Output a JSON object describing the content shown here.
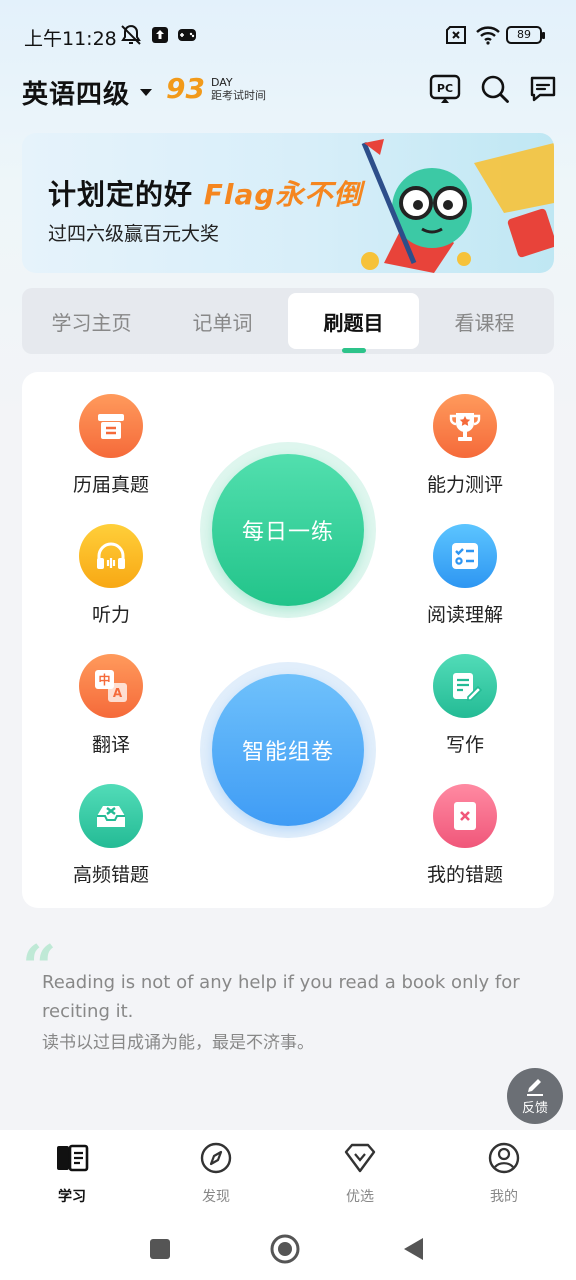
{
  "status_bar": {
    "time": "上午11:28",
    "battery": "89"
  },
  "header": {
    "exam_title": "英语四级",
    "countdown_number": "93",
    "countdown_unit": "DAY",
    "countdown_label": "距考试时间",
    "pc_icon_text": "PC"
  },
  "banner": {
    "title_prefix": "计划定的好",
    "title_highlight": "Flag永不倒",
    "subtitle": "过四六级赢百元大奖"
  },
  "tabs": [
    {
      "label": "学习主页",
      "active": false
    },
    {
      "label": "记单词",
      "active": false
    },
    {
      "label": "刷题目",
      "active": true
    },
    {
      "label": "看课程",
      "active": false
    }
  ],
  "features": {
    "past_exams": "历届真题",
    "ability_test": "能力测评",
    "listening": "听力",
    "reading": "阅读理解",
    "translation": "翻译",
    "writing": "写作",
    "frequent_mistakes": "高频错题",
    "my_mistakes": "我的错题"
  },
  "big_buttons": {
    "daily_practice": "每日一练",
    "smart_paper": "智能组卷"
  },
  "quote": {
    "english": "Reading is not of any help if you read a book only for reciting it.",
    "chinese": "读书以过目成诵为能，最是不济事。"
  },
  "feedback_label": "反馈",
  "bottom_nav": [
    {
      "label": "学习",
      "icon": "book-icon",
      "active": true
    },
    {
      "label": "发现",
      "icon": "compass-icon",
      "active": false
    },
    {
      "label": "优选",
      "icon": "diamond-icon",
      "active": false
    },
    {
      "label": "我的",
      "icon": "user-icon",
      "active": false
    }
  ],
  "colors": {
    "accent_green": "#22c48a",
    "accent_blue": "#3f9cf5",
    "countdown_orange": "#f29a1a"
  }
}
